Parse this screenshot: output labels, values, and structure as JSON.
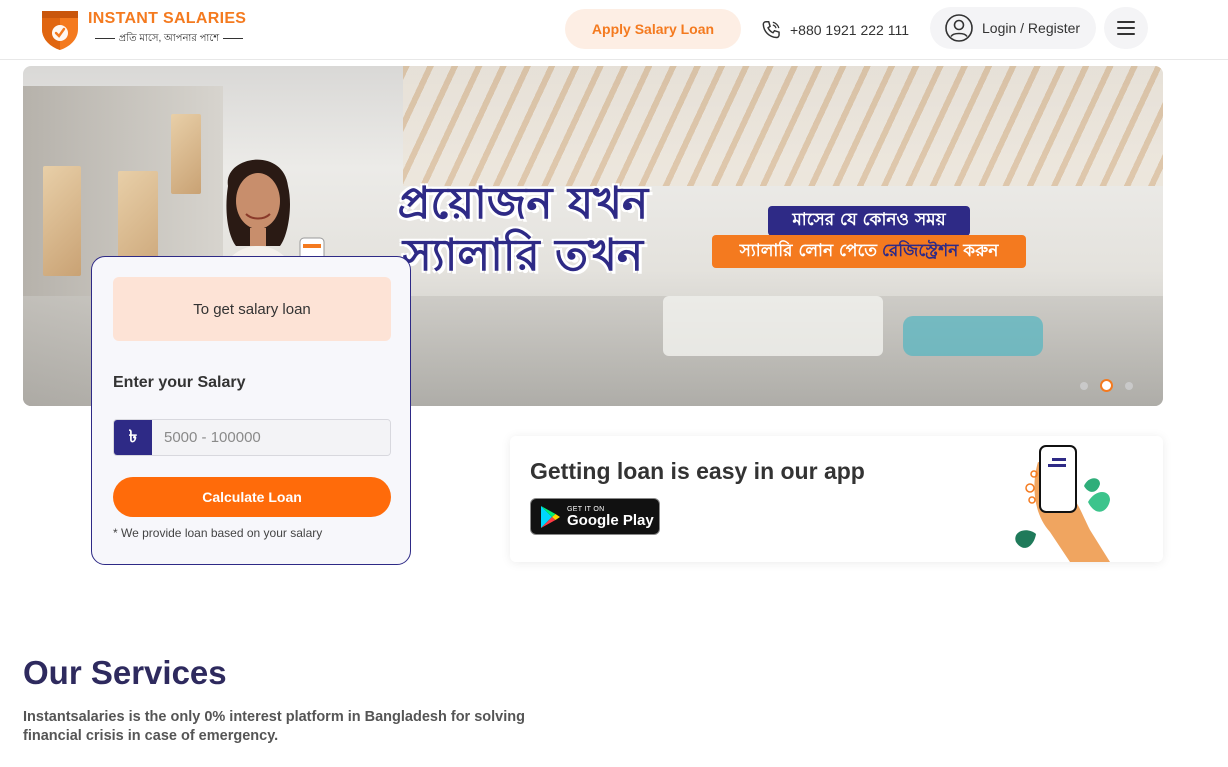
{
  "brand": {
    "name": "INSTANT SALARIES",
    "tagline": "প্রতি মাসে, আপনার পাশে",
    "accent_color": "#f47a1f",
    "primary_color": "#2e2a86"
  },
  "header": {
    "apply_label": "Apply Salary Loan",
    "phone_icon": "phone-icon",
    "phone_number": "+880 1921 222 111",
    "login_icon": "user-circle-icon",
    "login_label": "Login / Register",
    "menu_icon": "hamburger-menu-icon"
  },
  "hero": {
    "headline_line1": "প্রয়োজন যখন",
    "headline_line2": "স্যালারি তখন",
    "badge_top": "মাসের যে কোনও সময়",
    "badge_bottom_pre": "স্যালারি লোন পেতে",
    "badge_bottom_highlight": "রেজিস্ট্রেশন",
    "badge_bottom_post": "করুন",
    "slides_total": 3,
    "active_slide": 2
  },
  "salary_card": {
    "banner": "To get salary loan",
    "label": "Enter your Salary",
    "currency_symbol": "৳",
    "input_placeholder": "5000 - 100000",
    "button_label": "Calculate Loan",
    "note": "* We provide loan based on your salary"
  },
  "app_promo": {
    "title": "Getting loan is easy in our app",
    "store_small": "GET IT ON",
    "store_big": "Google Play",
    "store_icon": "google-play-icon"
  },
  "services": {
    "title": "Our Services",
    "description": "Instantsalaries is the only 0% interest platform in Bangladesh for solving financial crisis in case of emergency."
  }
}
